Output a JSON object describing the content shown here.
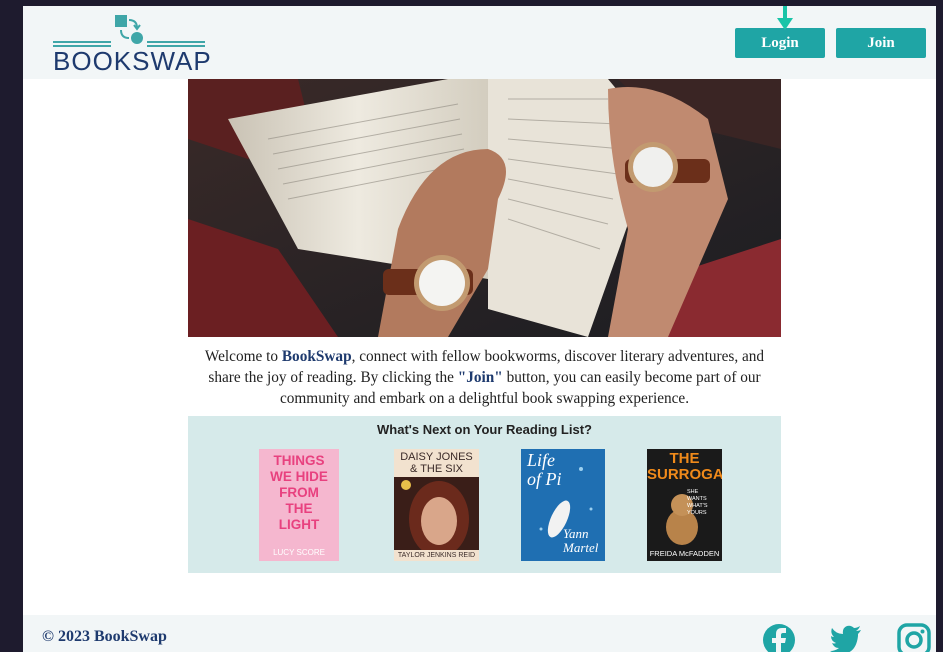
{
  "header": {
    "logo_text": "BOOKSWAP",
    "login_label": "Login",
    "join_label": "Join"
  },
  "intro": {
    "part1": "Welcome to ",
    "brand": "BookSwap",
    "part2": ", connect with fellow bookworms, discover literary adventures, and share the joy of reading. By clicking the ",
    "join": "\"Join\"",
    "part3": " button, you can easily become part of our community and embark on a delightful book swapping experience."
  },
  "reading": {
    "title": "What's Next on Your Reading List?",
    "books": [
      {
        "title_lines": [
          "THINGS",
          "WE HIDE",
          "FROM",
          "THE",
          "LIGHT"
        ],
        "author": "LUCY SCORE"
      },
      {
        "title_lines": [
          "DAISY JONES",
          "& THE SIX"
        ],
        "author": "TAYLOR JENKINS REID"
      },
      {
        "title_lines": [
          "Life",
          "of Pi"
        ],
        "author_lines": [
          "Yann",
          "Martel"
        ]
      },
      {
        "title_lines": [
          "THE",
          "SURROGATE"
        ],
        "subtitle": "SHE WANTS WHAT'S YOURS",
        "author": "FREIDA McFADDEN"
      }
    ]
  },
  "footer": {
    "copyright": "© 2023 BookSwap"
  },
  "icons": {
    "social": [
      "facebook-icon",
      "twitter-icon",
      "instagram-icon"
    ]
  },
  "colors": {
    "accent": "#1fa5a5",
    "brand": "#1e3a6e",
    "panel": "#d6eaea"
  }
}
